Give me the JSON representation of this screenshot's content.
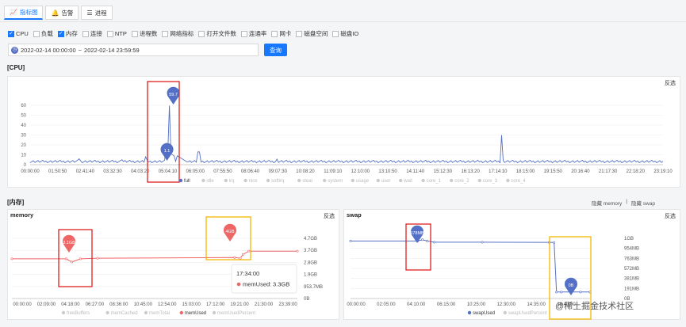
{
  "tabs": [
    {
      "label": "指标图",
      "icon": "chart-icon",
      "active": true
    },
    {
      "label": "告警",
      "icon": "bell-icon",
      "active": false
    },
    {
      "label": "进程",
      "icon": "list-icon",
      "active": false
    }
  ],
  "metrics": [
    {
      "label": "CPU",
      "checked": true
    },
    {
      "label": "负载",
      "checked": false
    },
    {
      "label": "内存",
      "checked": true
    },
    {
      "label": "连接",
      "checked": false
    },
    {
      "label": "NTP",
      "checked": false
    },
    {
      "label": "进程数",
      "checked": false
    },
    {
      "label": "网络指标",
      "checked": false
    },
    {
      "label": "打开文件数",
      "checked": false
    },
    {
      "label": "连通率",
      "checked": false
    },
    {
      "label": "网卡",
      "checked": false
    },
    {
      "label": "磁盘空间",
      "checked": false
    },
    {
      "label": "磁盘IO",
      "checked": false
    }
  ],
  "date_range": {
    "start": "2022-02-14 00:00:00",
    "separator": "~",
    "end": "2022-02-14 23:59:59"
  },
  "query_label": "查询",
  "cpu_section": {
    "heading": "[CPU]",
    "invert_label": "反选",
    "y_ticks": [
      "60",
      "50",
      "40",
      "30",
      "20",
      "10",
      "0"
    ],
    "x_ticks": [
      "00:00:00",
      "01:50:50",
      "02:41:40",
      "03:32:30",
      "04:03:20",
      "05:04:10",
      "06:05:00",
      "07:55:50",
      "08:06:40",
      "09:07:30",
      "10:08:20",
      "11:09:10",
      "12:10:00",
      "13:10:50",
      "14:11:40",
      "15:12:30",
      "16:13:20",
      "17:14:10",
      "18:15:00",
      "19:15:50",
      "20:16:40",
      "21:17:30",
      "22:18:20",
      "23:19:10"
    ],
    "markers": [
      {
        "label": "59.7",
        "color": "#5470c6"
      },
      {
        "label": "1.1",
        "color": "#5470c6"
      }
    ],
    "legend": [
      "full",
      "idle",
      "irq",
      "nice",
      "softirq",
      "steal",
      "system",
      "usage",
      "user",
      "wait",
      "core_1",
      "core_2",
      "core_3",
      "core_4"
    ],
    "legend_active": "full"
  },
  "mem_section": {
    "heading": "[内存]",
    "hide_memory": "隐藏 memory",
    "divider": "|",
    "hide_swap": "隐藏 swap"
  },
  "memory_chart": {
    "title": "memory",
    "invert_label": "反选",
    "y_ticks": [
      "4.7GB",
      "3.7GB",
      "2.8GB",
      "1.9GB",
      "953.7MB",
      "0B"
    ],
    "x_ticks": [
      "00:00:00",
      "02:09:00",
      "04:18:00",
      "06:27:00",
      "08:36:00",
      "10:45:00",
      "12:54:00",
      "15:03:00",
      "17:12:00",
      "19:21:00",
      "21:30:00",
      "23:39:00"
    ],
    "markers": [
      {
        "label": "3.1GB",
        "color": "#ee6666"
      },
      {
        "label": "4GB",
        "color": "#ee6666"
      }
    ],
    "tooltip": {
      "time": "17:34:00",
      "series": "memUsed",
      "value": "3.3GB"
    },
    "legend": [
      "freeBuffers",
      "memCached",
      "memTotal",
      "memUsed",
      "memUsedPercent"
    ],
    "legend_active": "memUsed"
  },
  "swap_chart": {
    "title": "swap",
    "invert_label": "反选",
    "y_ticks": [
      "1GB",
      "954MB",
      "763MB",
      "572MB",
      "381MB",
      "191MB",
      "0B"
    ],
    "x_ticks": [
      "00:00:00",
      "02:05:00",
      "04:10:00",
      "06:15:00",
      "10:25:00",
      "12:30:00",
      "14:35:00",
      "16:40:00"
    ],
    "markers": [
      {
        "label": "978MB",
        "color": "#5470c6"
      },
      {
        "label": "0B",
        "color": "#5470c6"
      }
    ],
    "legend": [
      "swapUsed",
      "swapUsedPercent"
    ],
    "legend_active": "swapUsed"
  },
  "watermark": "@稀土掘金技术社区",
  "colors": {
    "accent": "#1677ff",
    "cpu_line": "#5470c6",
    "mem_line": "#ee6666",
    "swap_line": "#5470c6",
    "highlight_red": "#e02020",
    "highlight_yellow": "#f5b800"
  }
}
